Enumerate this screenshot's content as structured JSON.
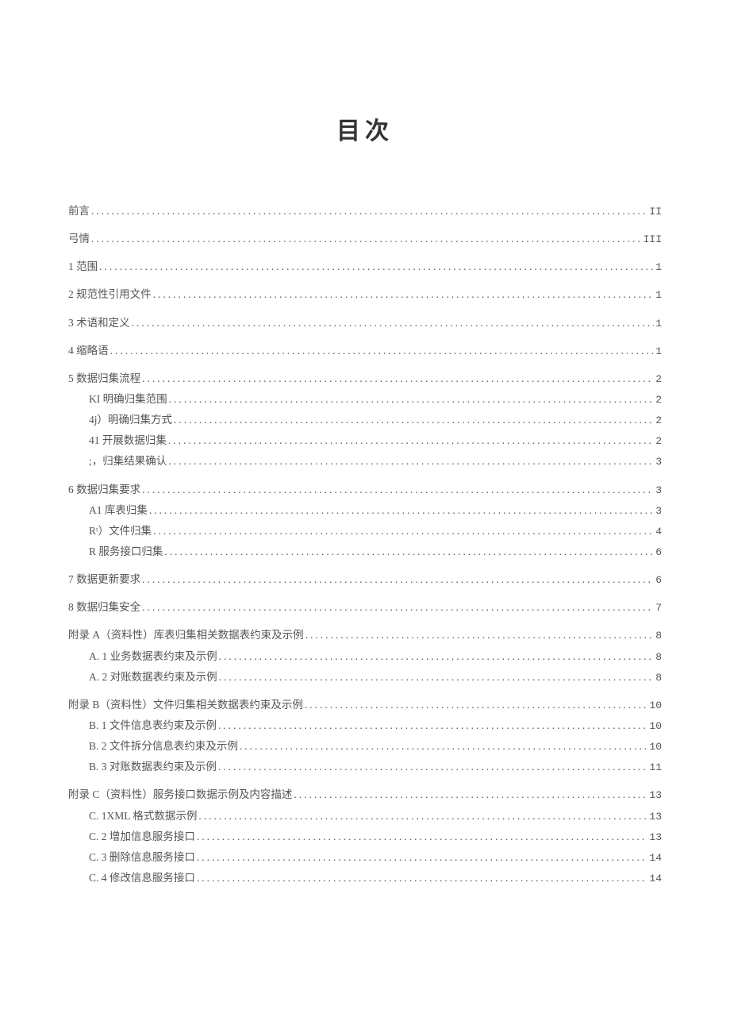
{
  "title": "目次",
  "entries": [
    {
      "label": "前言",
      "page": "II",
      "indent": 0,
      "gap": false
    },
    {
      "label": "弓情",
      "page": "III",
      "indent": 0,
      "gap": true
    },
    {
      "label": "1 范围",
      "page": "1",
      "indent": 0,
      "gap": true
    },
    {
      "label": "2 规范性引用文件",
      "page": "1",
      "indent": 0,
      "gap": true
    },
    {
      "label": "3 术语和定义",
      "page": "1",
      "indent": 0,
      "gap": true
    },
    {
      "label": "4 缩略语",
      "page": "1",
      "indent": 0,
      "gap": true
    },
    {
      "label": "5 数据归集流程",
      "page": "2",
      "indent": 0,
      "gap": true
    },
    {
      "label": "KI 明确归集范围",
      "page": "2",
      "indent": 1,
      "gap": false
    },
    {
      "label": "4j）明确归集方式",
      "page": "2",
      "indent": 1,
      "gap": false
    },
    {
      "label": "41 开展数据归集",
      "page": "2",
      "indent": 1,
      "gap": false
    },
    {
      "label": ";，归集结果确认",
      "page": "3",
      "indent": 1,
      "gap": false
    },
    {
      "label": "6 数据归集要求",
      "page": "3",
      "indent": 0,
      "gap": true
    },
    {
      "label": "A1 库表归集",
      "page": "3",
      "indent": 1,
      "gap": false
    },
    {
      "label": "Rᵗ）文件归集",
      "page": "4",
      "indent": 1,
      "gap": false
    },
    {
      "label": "R 服务接口归集",
      "page": "6",
      "indent": 1,
      "gap": false
    },
    {
      "label": "7 数据更新要求",
      "page": "6",
      "indent": 0,
      "gap": true
    },
    {
      "label": "8 数据归集安全",
      "page": "7",
      "indent": 0,
      "gap": true
    },
    {
      "label": "附录 A（资料性）库表归集相关数据表约束及示例",
      "page": "8",
      "indent": 0,
      "gap": true
    },
    {
      "label": "A. 1 业务数据表约束及示例",
      "page": "8",
      "indent": 1,
      "gap": false
    },
    {
      "label": "A.  2 对账数据表约束及示例",
      "page": "8",
      "indent": 1,
      "gap": false
    },
    {
      "label": "附录 B（资料性）文件归集相关数据表约束及示例",
      "page": "10",
      "indent": 0,
      "gap": true
    },
    {
      "label": "B.  1 文件信息表约束及示例",
      "page": "10",
      "indent": 1,
      "gap": false
    },
    {
      "label": "B.  2 文件拆分信息表约束及示例",
      "page": "10",
      "indent": 1,
      "gap": false
    },
    {
      "label": "B. 3 对账数据表约束及示例",
      "page": "11",
      "indent": 1,
      "gap": false
    },
    {
      "label": "附录 C（资料性）服务接口数据示例及内容描述",
      "page": "13",
      "indent": 0,
      "gap": true
    },
    {
      "label": "C.  1XML 格式数据示例",
      "page": "13",
      "indent": 1,
      "gap": false
    },
    {
      "label": "C. 2 增加信息服务接口",
      "page": "13",
      "indent": 1,
      "gap": false
    },
    {
      "label": "C. 3 删除信息服务接口",
      "page": "14",
      "indent": 1,
      "gap": false
    },
    {
      "label": "C. 4 修改信息服务接口",
      "page": "14",
      "indent": 1,
      "gap": false
    }
  ]
}
